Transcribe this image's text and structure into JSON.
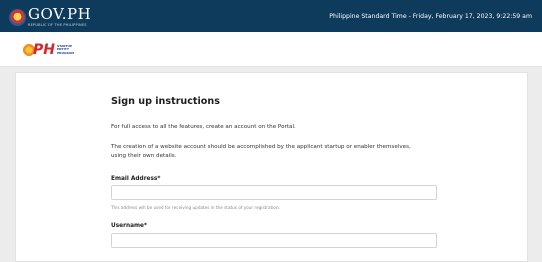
{
  "gov_bar": {
    "title": "GOV.PH",
    "subtitle": "REPUBLIC OF THE PHILIPPINES",
    "time_text": "Philippine Standard Time - Friday, February 17, 2023, 9:22:59 am"
  },
  "portal": {
    "logo_text": "PH",
    "logo_words": [
      "STARTUP",
      "ENTITY",
      "PROGRAM"
    ]
  },
  "form": {
    "heading": "Sign up instructions",
    "paragraph1": "For full access to all the features, create an account on the Portal.",
    "paragraph2": "The creation of a website account should be accomplished by the applicant startup or enabler themselves, using their own details.",
    "email_label": "Email Address*",
    "email_value": "",
    "email_hint": "This address will be used for receiving updates in the status of your registration.",
    "username_label": "Username*",
    "username_value": ""
  },
  "colors": {
    "gov_bar": "#0e3b5c",
    "page_bg": "#ececec",
    "card_bg": "#ffffff"
  }
}
